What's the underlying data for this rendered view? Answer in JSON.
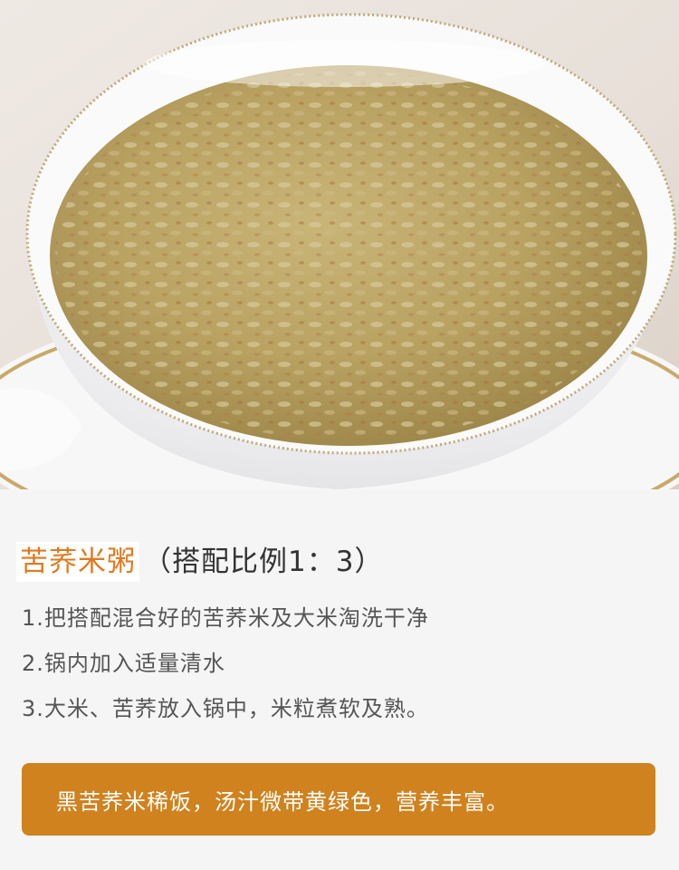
{
  "hero": {
    "image": "buckwheat-rice-porridge-photo"
  },
  "recipe": {
    "title": "苦荞米粥",
    "ratio": "（搭配比例1：3）",
    "steps": [
      "1.把搭配混合好的苦荞米及大米淘洗干净",
      "2.锅内加入适量清水",
      "3.大米、苦荞放入锅中，米粒煮软及熟。"
    ],
    "note": "黑苦荞米稀饭，汤汁微带黄绿色，营养丰富。"
  },
  "colors": {
    "accent": "#e07a1f",
    "note_bg": "#d0821e",
    "text": "#555555"
  }
}
